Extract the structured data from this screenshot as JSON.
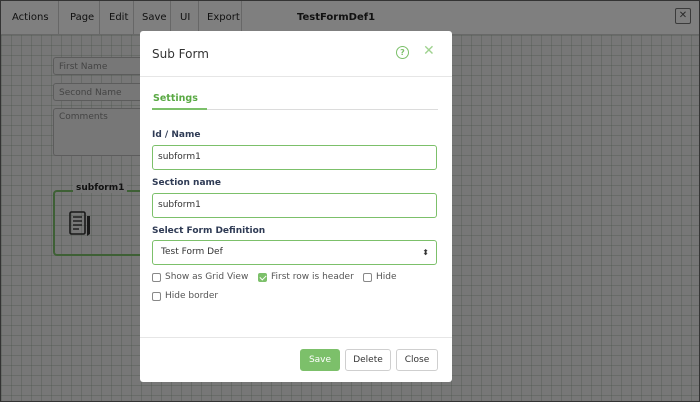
{
  "toolbar": {
    "actions": "Actions",
    "page": "Page",
    "edit": "Edit",
    "save": "Save",
    "ui": "UI",
    "export": "Export",
    "form_title": "TestFormDef1"
  },
  "canvas": {
    "first_name_placeholder": "First Name",
    "second_name_placeholder": "Second Name",
    "comments_placeholder": "Comments",
    "subform_label": "subform1"
  },
  "modal": {
    "title": "Sub Form",
    "tab_settings": "Settings",
    "id_label": "Id / Name",
    "id_value": "subform1",
    "section_label": "Section name",
    "section_value": "subform1",
    "form_def_label": "Select Form Definition",
    "form_def_value": "Test Form Def",
    "options": {
      "grid_view": {
        "label": "Show as Grid View",
        "checked": false
      },
      "first_row_header": {
        "label": "First row is header",
        "checked": true
      },
      "hide": {
        "label": "Hide",
        "checked": false
      },
      "hide_border": {
        "label": "Hide border",
        "checked": false
      }
    },
    "buttons": {
      "save": "Save",
      "delete": "Delete",
      "close": "Close"
    }
  },
  "colors": {
    "accent": "#7cc06a",
    "overlay": "#000000"
  }
}
